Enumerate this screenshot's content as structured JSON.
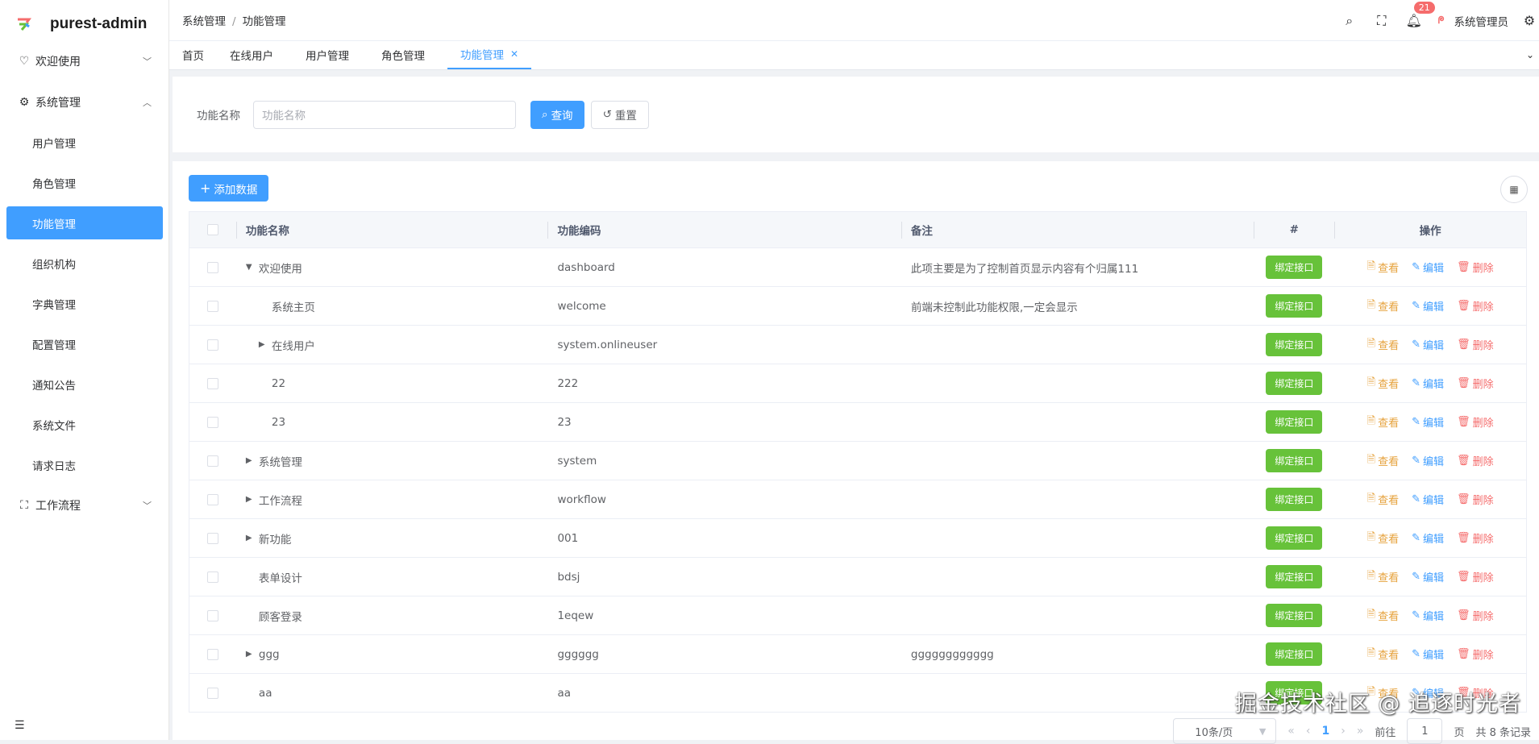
{
  "app": {
    "title": "purest-admin"
  },
  "sidebar": {
    "welcome": "欢迎使用",
    "system": "系统管理",
    "workflow": "工作流程",
    "sub_items": [
      "用户管理",
      "角色管理",
      "功能管理",
      "组织机构",
      "字典管理",
      "配置管理",
      "通知公告",
      "系统文件",
      "请求日志"
    ],
    "active": "功能管理"
  },
  "header": {
    "breadcrumb": [
      "系统管理",
      "功能管理"
    ],
    "notification_count": "21",
    "user_name": "系统管理员"
  },
  "tabs": [
    "首页",
    "在线用户",
    "用户管理",
    "角色管理",
    "功能管理"
  ],
  "search": {
    "label": "功能名称",
    "placeholder": "功能名称",
    "query_label": "查询",
    "reset_label": "重置"
  },
  "toolbar": {
    "add_label": "添加数据"
  },
  "table": {
    "columns": [
      "功能名称",
      "功能编码",
      "备注",
      "#",
      "操作"
    ],
    "bind_label": "绑定接口",
    "view_label": "查看",
    "edit_label": "编辑",
    "delete_label": "删除",
    "rows": [
      {
        "name": "欢迎使用",
        "code": "dashboard",
        "remark": "此项主要是为了控制首页显示内容有个归属111",
        "level": 0,
        "expander": "expanded"
      },
      {
        "name": "系统主页",
        "code": "welcome",
        "remark": "前端未控制此功能权限,一定会显示",
        "level": 1,
        "expander": "none"
      },
      {
        "name": "在线用户",
        "code": "system.onlineuser",
        "remark": "",
        "level": 1,
        "expander": "collapsed"
      },
      {
        "name": "22",
        "code": "222",
        "remark": "",
        "level": 1,
        "expander": "none"
      },
      {
        "name": "23",
        "code": "23",
        "remark": "",
        "level": 1,
        "expander": "none"
      },
      {
        "name": "系统管理",
        "code": "system",
        "remark": "",
        "level": 0,
        "expander": "collapsed"
      },
      {
        "name": "工作流程",
        "code": "workflow",
        "remark": "",
        "level": 0,
        "expander": "collapsed"
      },
      {
        "name": "新功能",
        "code": "001",
        "remark": "",
        "level": 0,
        "expander": "collapsed"
      },
      {
        "name": "表单设计",
        "code": "bdsj",
        "remark": "",
        "level": 0,
        "expander": "none"
      },
      {
        "name": "顾客登录",
        "code": "1eqew",
        "remark": "",
        "level": 0,
        "expander": "none"
      },
      {
        "name": "ggg",
        "code": "gggggg",
        "remark": "gggggggggggg",
        "level": 0,
        "expander": "collapsed"
      },
      {
        "name": "aa",
        "code": "aa",
        "remark": "",
        "level": 0,
        "expander": "none"
      }
    ]
  },
  "pagination": {
    "page_size": "10条/页",
    "current": "1",
    "goto_label": "前往",
    "goto_value": "1",
    "page_suffix": "页",
    "total": "共 8 条记录"
  },
  "watermark": "掘金技术社区 @ 追逐时光者",
  "colors": {
    "primary": "#409eff",
    "success": "#67c23a",
    "warning": "#e6a23c",
    "danger": "#f56c6c"
  }
}
